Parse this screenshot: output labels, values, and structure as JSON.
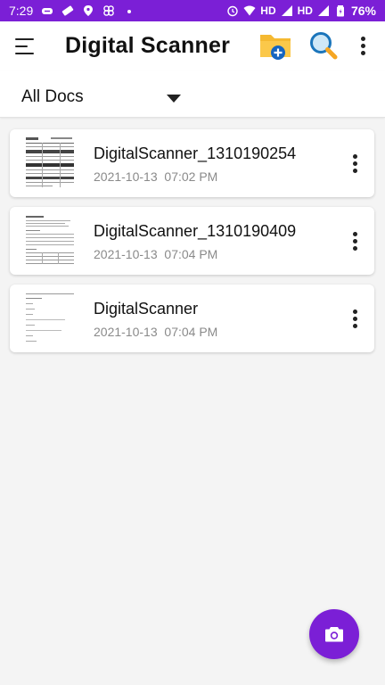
{
  "status_bar": {
    "time": "7:29",
    "network_labels": [
      "HD",
      "HD"
    ],
    "battery": "76%",
    "icons_left": [
      "cloud-link-icon",
      "ticket-icon",
      "location-pin-icon",
      "pinwheel-icon",
      "dot-icon"
    ],
    "icons_right": [
      "alarm-icon",
      "wifi-icon",
      "signal-icon",
      "battery-icon"
    ]
  },
  "app_bar": {
    "title": "Digital Scanner",
    "actions": [
      "new-folder-icon",
      "search-icon",
      "more-vertical-icon"
    ]
  },
  "filter": {
    "selected": "All Docs"
  },
  "documents": [
    {
      "name": "DigitalScanner_1310190254",
      "date": "2021-10-13",
      "time": "07:02 PM"
    },
    {
      "name": "DigitalScanner_1310190409",
      "date": "2021-10-13",
      "time": "07:04 PM"
    },
    {
      "name": "DigitalScanner",
      "date": "2021-10-13",
      "time": "07:04 PM"
    }
  ],
  "fab": {
    "icon": "camera-icon"
  },
  "colors": {
    "primary": "#7b1fd6",
    "background": "#f4f4f4",
    "card": "#ffffff",
    "date_text": "#8a8a8a"
  }
}
